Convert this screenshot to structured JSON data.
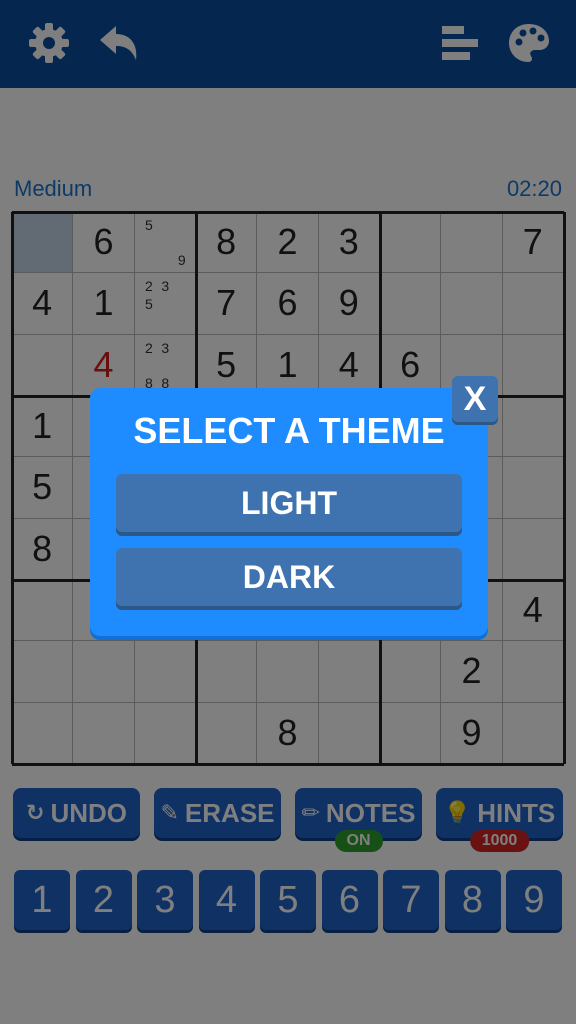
{
  "header": {
    "icons": [
      "gear-icon",
      "undo-arrow-icon",
      "leaderboard-icon",
      "palette-icon"
    ],
    "color": "#0a4d9e"
  },
  "game": {
    "difficulty": "Medium",
    "timer": "02:20"
  },
  "board": [
    [
      "",
      "6",
      "",
      "8",
      "2",
      "3",
      "",
      "",
      "7"
    ],
    [
      "4",
      "1",
      "",
      "7",
      "6",
      "9",
      "",
      "",
      ""
    ],
    [
      "",
      "4",
      "",
      "5",
      "1",
      "4",
      "6",
      "",
      ""
    ],
    [
      "1",
      "",
      "",
      "",
      "",
      "",
      "",
      "",
      ""
    ],
    [
      "5",
      "",
      "",
      "",
      "",
      "",
      "",
      "",
      ""
    ],
    [
      "8",
      "",
      "",
      "",
      "",
      "",
      "",
      "",
      ""
    ],
    [
      "",
      "",
      "",
      "",
      "",
      "",
      "",
      "",
      "4"
    ],
    [
      "",
      "",
      "",
      "",
      "",
      "",
      "",
      "2",
      ""
    ],
    [
      "",
      "",
      "",
      "",
      "8",
      "",
      "",
      "9",
      ""
    ]
  ],
  "red_cells": [
    [
      2,
      1
    ]
  ],
  "selected_cell": [
    0,
    0
  ],
  "notes": [
    {
      "row": 0,
      "col": 2,
      "cells": [
        "5",
        "",
        "",
        "",
        "",
        "",
        "",
        "",
        "9"
      ]
    },
    {
      "row": 1,
      "col": 2,
      "cells": [
        "2",
        "3",
        "",
        "5",
        "",
        "",
        "",
        "",
        ""
      ]
    },
    {
      "row": 2,
      "col": 2,
      "cells": [
        "2",
        "3",
        "",
        "",
        "",
        "",
        "8",
        "8",
        ""
      ]
    }
  ],
  "controls": {
    "undo": "UNDO",
    "erase": "ERASE",
    "notes": "NOTES",
    "notes_state": "ON",
    "hints": "HINTS",
    "hints_count": "1000"
  },
  "number_pad": [
    "1",
    "2",
    "3",
    "4",
    "5",
    "6",
    "7",
    "8",
    "9"
  ],
  "dialog": {
    "title": "SELECT A THEME",
    "options": [
      "LIGHT",
      "DARK"
    ],
    "close": "X",
    "color": "#1e8cff"
  }
}
